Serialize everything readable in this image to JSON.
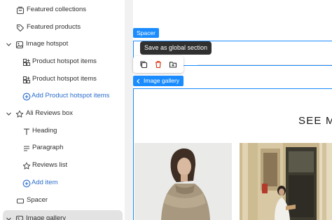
{
  "sidebar": {
    "items": [
      {
        "label": "Featured collections",
        "icon": "collection-icon",
        "level": 1
      },
      {
        "label": "Featured products",
        "icon": "tag-icon",
        "level": 1
      },
      {
        "label": "Image hotspot",
        "icon": "image-icon",
        "level": 0,
        "expanded": true
      },
      {
        "label": "Product hotspot items",
        "icon": "blocks-icon",
        "level": 2
      },
      {
        "label": "Product hotspot items",
        "icon": "blocks-icon",
        "level": 2
      },
      {
        "label": "Add Product hotspot items",
        "icon": "add-circle-icon",
        "level": 2,
        "link": true
      },
      {
        "label": "Ali Reviews box",
        "icon": "star-icon",
        "level": 0,
        "expanded": true
      },
      {
        "label": "Heading",
        "icon": "text-icon",
        "level": 2
      },
      {
        "label": "Paragraph",
        "icon": "paragraph-icon",
        "level": 2
      },
      {
        "label": "Reviews list",
        "icon": "star-icon",
        "level": 2
      },
      {
        "label": "Add item",
        "icon": "add-circle-icon",
        "level": 2,
        "link": true
      },
      {
        "label": "Spacer",
        "icon": "spacer-icon",
        "level": 1
      },
      {
        "label": "Image gallery",
        "icon": "image-icon",
        "level": 0,
        "expanded": true,
        "selected": true
      }
    ]
  },
  "canvas": {
    "spacer_badge": "Spacer",
    "tooltip": "Save as global section",
    "toolbar_icons": [
      "duplicate-icon",
      "delete-icon",
      "save-to-folder-icon"
    ],
    "gallery_badge": "Image gallery",
    "heading_text": "SEE MO"
  },
  "colors": {
    "accent": "#1a8cff",
    "link": "#2c6ecb",
    "selected_bg": "#e3e3e3",
    "delete": "#d72c0d",
    "tooltip_bg": "#303030"
  }
}
